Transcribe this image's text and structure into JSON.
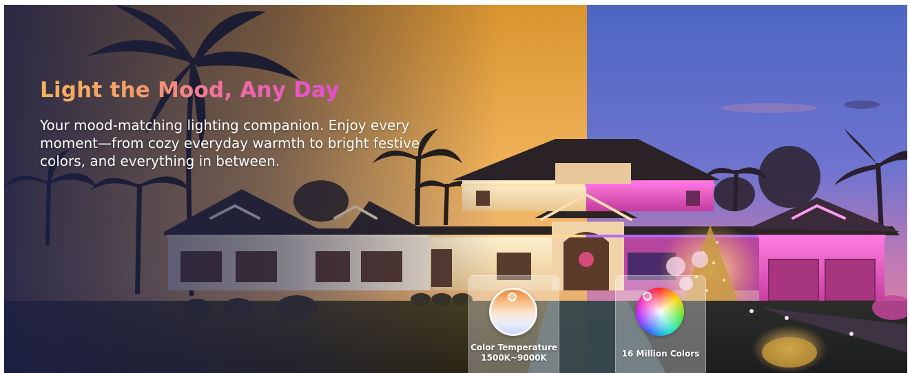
{
  "hero": {
    "headline": "Light the Mood, Any Day",
    "subtitle": "Your mood-matching lighting companion. Enjoy every moment—from cozy everyday warmth to bright festive colors, and everything in between."
  },
  "features": [
    {
      "label": "Color Temperature",
      "range": "1500K~9000K",
      "icon": "color-temperature-dial-icon"
    },
    {
      "label": "16 Million Colors",
      "icon": "color-wheel-icon"
    }
  ],
  "colors": {
    "headline_gradient": [
      "#f2b25a",
      "#f06fa2",
      "#e64bd6"
    ],
    "warm_sky": "#e9a33f",
    "cool_sky": "#6e6fd0",
    "pink_lights": "#ff3fc8",
    "warm_lights": "#ffd27a"
  }
}
